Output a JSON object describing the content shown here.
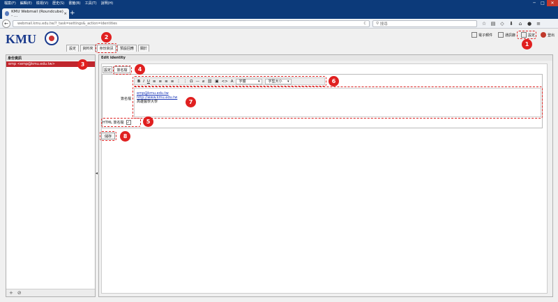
{
  "menubar": [
    "檔案(F)",
    "編輯(E)",
    "檢視(V)",
    "歷史(S)",
    "書籤(B)",
    "工具(T)",
    "說明(H)"
  ],
  "window_controls": [
    "─",
    "□",
    "✕"
  ],
  "browser": {
    "tab_title": "KMU Webmail (Roundcube) - ...",
    "tab_close": "×",
    "new_tab": "+",
    "url": "webmail.kmu.edu.tw/?_task=settings&_action=identities",
    "reload": "C",
    "search_placeholder": "搜尋"
  },
  "header": {
    "logo": "KMU",
    "tools": {
      "email": "電子郵件",
      "contacts": "通訊錄",
      "settings": "設定",
      "logout": "登出"
    }
  },
  "top_tabs": [
    "設定",
    "資料夾",
    "身份資訊",
    "預設回應",
    "關於"
  ],
  "left_panel": {
    "title": "身份資訊",
    "items": [
      "emp <emp@kmu.edu.tw>"
    ],
    "footer_add": "+",
    "footer_delete": "⊘"
  },
  "right_panel": {
    "title": "Edit identity",
    "sub_tabs": [
      "設定",
      "簽名檔"
    ],
    "signature_label": "簽名檔",
    "toolbar": {
      "buttons": [
        "B",
        "I",
        "U",
        "≡",
        "≡",
        "≡",
        "≡",
        "⋮",
        "⋮",
        "Ω",
        "—",
        "⌀",
        "⛓",
        "▣",
        "<>",
        "A"
      ],
      "font_select": "字體",
      "size_select": "字型大小"
    },
    "editor_lines": [
      "emp@kmu.edu.tw",
      "http://www.kmu.edu.tw",
      "高雄醫學大學"
    ],
    "html_signature_label": "HTML 簽名檔",
    "html_signature_checked": "✓",
    "save_button": "儲存"
  },
  "annotations": [
    "1",
    "2",
    "3",
    "4",
    "5",
    "6",
    "7",
    "8"
  ],
  "splitter": "◂",
  "colors": {
    "accent": "#c0262d",
    "annotation": "#e02020",
    "brand": "#1a3a8c",
    "titlebar": "#0c3a7a"
  }
}
